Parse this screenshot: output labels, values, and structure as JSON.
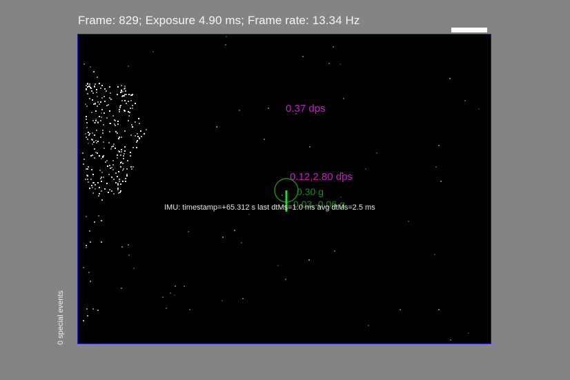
{
  "header": {
    "status": "Frame: 829; Exposure 4.90 ms; Frame rate: 13.34 Hz"
  },
  "overlay": {
    "rotation_rate": "0.37 dps",
    "pan_tilt_rate": "0.12,2.80 dps",
    "accel_magnitude": "0.30 g",
    "accel_xy": "0.03,-0.06 g",
    "imu_text": "IMU: timestamp=+65.312  s last dtMs=1.0   ms  avg dtMs=2.5   ms"
  },
  "side": {
    "special_events": "0 special events"
  },
  "colors": {
    "background": "#848484",
    "viewport": "#000000",
    "viewport_border": "#2020c8",
    "gyro": "#c81ec8",
    "accel": "#1b8a1b",
    "accel_vector": "#22dd22",
    "event_pixel": "#ffffff"
  }
}
